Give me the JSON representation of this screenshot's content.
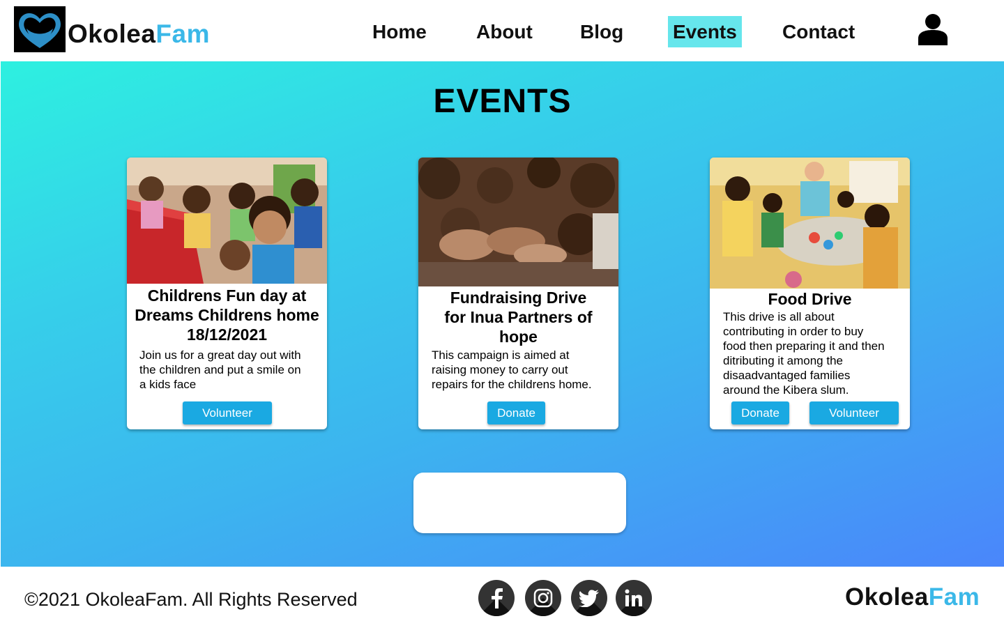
{
  "header": {
    "brand_main": "Okolea",
    "brand_accent": "Fam",
    "nav": {
      "home": "Home",
      "about": "About",
      "blog": "Blog",
      "events": "Events",
      "contact": "Contact"
    },
    "active_nav": "Events",
    "icons": {
      "logo": "heart-hands-icon",
      "user": "user-icon"
    }
  },
  "main": {
    "title": "EVENTS",
    "cards": [
      {
        "title_lines": [
          "Childrens Fun day at",
          "Dreams Childrens home",
          "18/12/2021"
        ],
        "description_lines": [
          "Join us for a great day out with",
          "the children and put a smile on",
          "a kids face"
        ],
        "buttons": [
          "Volunteer"
        ],
        "image": "children-reading-photo"
      },
      {
        "title_lines": [
          "Fundraising Drive",
          "for Inua Partners of",
          "hope"
        ],
        "description_lines": [
          "This campaign is aimed at",
          "raising money to carry out",
          "repairs for the childrens home."
        ],
        "buttons": [
          "Donate"
        ],
        "image": "children-hands-photo"
      },
      {
        "title_lines": [
          "Food Drive"
        ],
        "description_lines": [
          "This drive is all about",
          "contributing in order to buy",
          "food then preparing it and then",
          "ditributing it among the",
          "disaadvantaged families",
          "around the Kibera slum."
        ],
        "buttons": [
          "Donate",
          "Volunteer"
        ],
        "image": "children-painting-photo"
      }
    ]
  },
  "footer": {
    "copyright": "©2021 OkoleaFam. All Rights Reserved",
    "brand_main": "Okolea",
    "brand_accent": "Fam",
    "social": [
      "facebook-icon",
      "instagram-icon",
      "twitter-icon",
      "linkedin-icon"
    ]
  },
  "colors": {
    "accent": "#3bb8e8",
    "active_nav_bg": "#66e6ec",
    "button": "#1aa9e2",
    "gradient_start": "#2df0e0",
    "gradient_end": "#4a86fb"
  }
}
